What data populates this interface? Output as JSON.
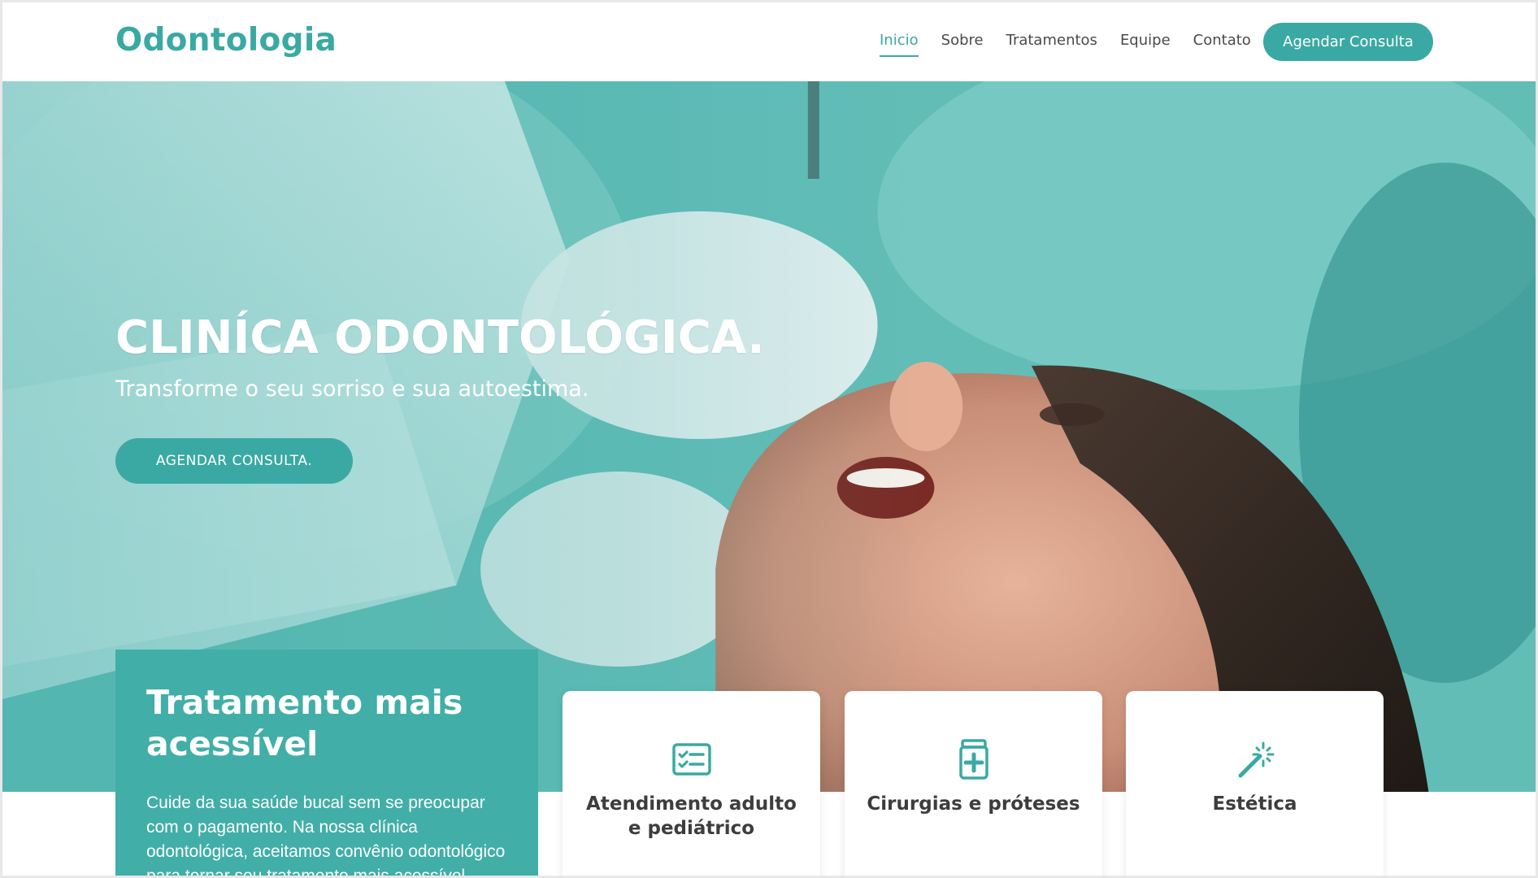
{
  "header": {
    "logo": "Odontologia",
    "nav": [
      {
        "label": "Inicio",
        "active": true
      },
      {
        "label": "Sobre"
      },
      {
        "label": "Tratamentos"
      },
      {
        "label": "Equipe"
      },
      {
        "label": "Contato"
      }
    ],
    "cta_label": "Agendar Consulta"
  },
  "hero": {
    "title": "CLINÍCA ODONTOLÓGICA.",
    "subtitle": "Transforme o seu sorriso e sua autoestima.",
    "cta_label": "AGENDAR CONSULTA."
  },
  "feature": {
    "title": "Tratamento mais acessível",
    "text": "Cuide da sua saúde bucal sem se preocupar com o pagamento. Na nossa clínica odontológica, aceitamos convênio odontológico para tornar seu tratamento mais acessível."
  },
  "services": [
    {
      "label": "Atendimento adulto e pediátrico",
      "icon": "checklist-icon"
    },
    {
      "label": "Cirurgias e próteses",
      "icon": "medicine-bottle-icon"
    },
    {
      "label": "Estética",
      "icon": "magic-wand-icon"
    }
  ],
  "colors": {
    "accent": "#3aa9a3",
    "card_text": "#3d3d3d",
    "nav_text": "#4a4a4a"
  }
}
